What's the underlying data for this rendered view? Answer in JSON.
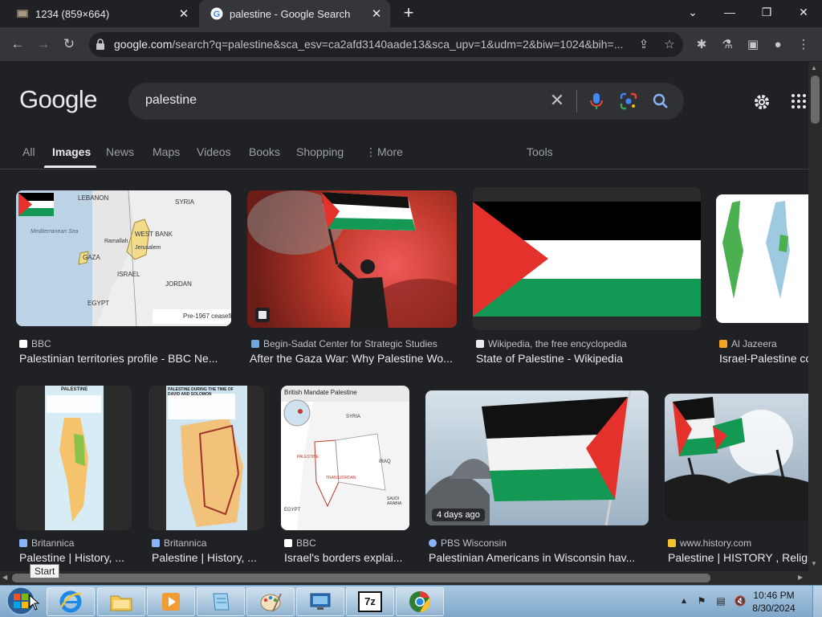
{
  "browser": {
    "tabs": [
      {
        "title": "1234 (859×664)"
      },
      {
        "title": "palestine - Google Search"
      }
    ],
    "url_domain": "google.com",
    "url_rest": "/search?q=palestine&sca_esv=ca2afd3140aade13&sca_upv=1&udm=2&biw=1024&bih=..."
  },
  "google": {
    "logo": "Google",
    "query": "palestine",
    "nav": [
      "All",
      "Images",
      "News",
      "Maps",
      "Videos",
      "Books",
      "Shopping",
      "More",
      "Tools"
    ]
  },
  "results": [
    {
      "source": "BBC",
      "title": "Palestinian territories profile - BBC Ne..."
    },
    {
      "source": "Begin-Sadat Center for Strategic Studies",
      "title": "After the Gaza War: Why Palestine Wo..."
    },
    {
      "source": "Wikipedia, the free encyclopedia",
      "title": "State of Palestine - Wikipedia"
    },
    {
      "source": "Al Jazeera",
      "title": "Israel-Palestine co"
    },
    {
      "source": "Britannica",
      "title": "Palestine | History, ..."
    },
    {
      "source": "Britannica",
      "title": "Palestine | History, ..."
    },
    {
      "source": "BBC",
      "title": "Israel's borders explai..."
    },
    {
      "source": "PBS Wisconsin",
      "title": "Palestinian Americans in Wisconsin hav..."
    },
    {
      "source": "www.history.com",
      "title": "Palestine | HISTORY , Religi"
    }
  ],
  "thumb_text": {
    "map1": {
      "lebanon": "LEBANON",
      "syria": "SYRIA",
      "med": "Mediterranean Sea",
      "westbank": "WEST BANK",
      "ramallah": "Ramallah",
      "jerusalem": "Jerusalem",
      "gaza": "GAZA",
      "israel": "ISRAEL",
      "jordan": "JORDAN",
      "egypt": "EGYPT",
      "legend": "Pre-1967 ceasefi"
    },
    "brit1": "PALESTINE",
    "brit2": "PALESTINE DURING THE TIME OF DAVID AND SOLOMON",
    "bbcmap": {
      "title": "British Mandate Palestine",
      "syria": "SYRIA",
      "palestine": "PALESTINE",
      "transjordan": "TRANSJORDAN",
      "iraq": "IRAQ",
      "saudi": "SAUDI ARABIA",
      "egypt": "EGYPT"
    },
    "badge": "4 days ago"
  },
  "taskbar": {
    "tooltip": "Start",
    "time": "10:46 PM",
    "date": "8/30/2024",
    "app_7z": "7z"
  },
  "colors": {
    "flag_black": "#000000",
    "flag_white": "#ffffff",
    "flag_green": "#149954",
    "flag_red": "#e4312b"
  }
}
